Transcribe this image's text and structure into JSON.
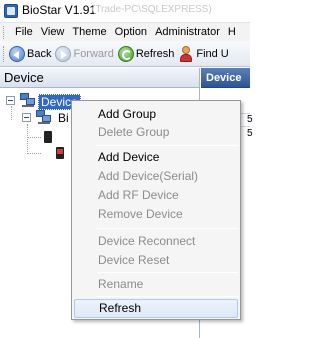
{
  "titlebar": {
    "title": "BioStar V1.91",
    "faded_text": "(Trade-PC\\SQLEXPRESS)"
  },
  "menubar": {
    "items": [
      "File",
      "View",
      "Theme",
      "Option",
      "Administrator",
      "H"
    ]
  },
  "toolbar": {
    "back_label": "Back",
    "forward_label": "Forward",
    "refresh_label": "Refresh",
    "find_label": "Find U"
  },
  "left_panel": {
    "header": "Device",
    "tree": {
      "root_label": "Device",
      "child_label": "Bi"
    }
  },
  "right_panel": {
    "header": "Device",
    "rows": [
      "5",
      "5"
    ]
  },
  "context_menu": {
    "items": [
      {
        "label": "Add Group",
        "enabled": true
      },
      {
        "label": "Delete Group",
        "enabled": false
      },
      {
        "label": "Add Device",
        "enabled": true
      },
      {
        "label": "Add Device(Serial)",
        "enabled": false
      },
      {
        "label": "Add RF Device",
        "enabled": false
      },
      {
        "label": "Remove Device",
        "enabled": false
      },
      {
        "label": "Device Reconnect",
        "enabled": false
      },
      {
        "label": "Device Reset",
        "enabled": false
      },
      {
        "label": "Rename",
        "enabled": false
      },
      {
        "label": "Refresh",
        "enabled": true,
        "highlighted": true
      }
    ]
  }
}
